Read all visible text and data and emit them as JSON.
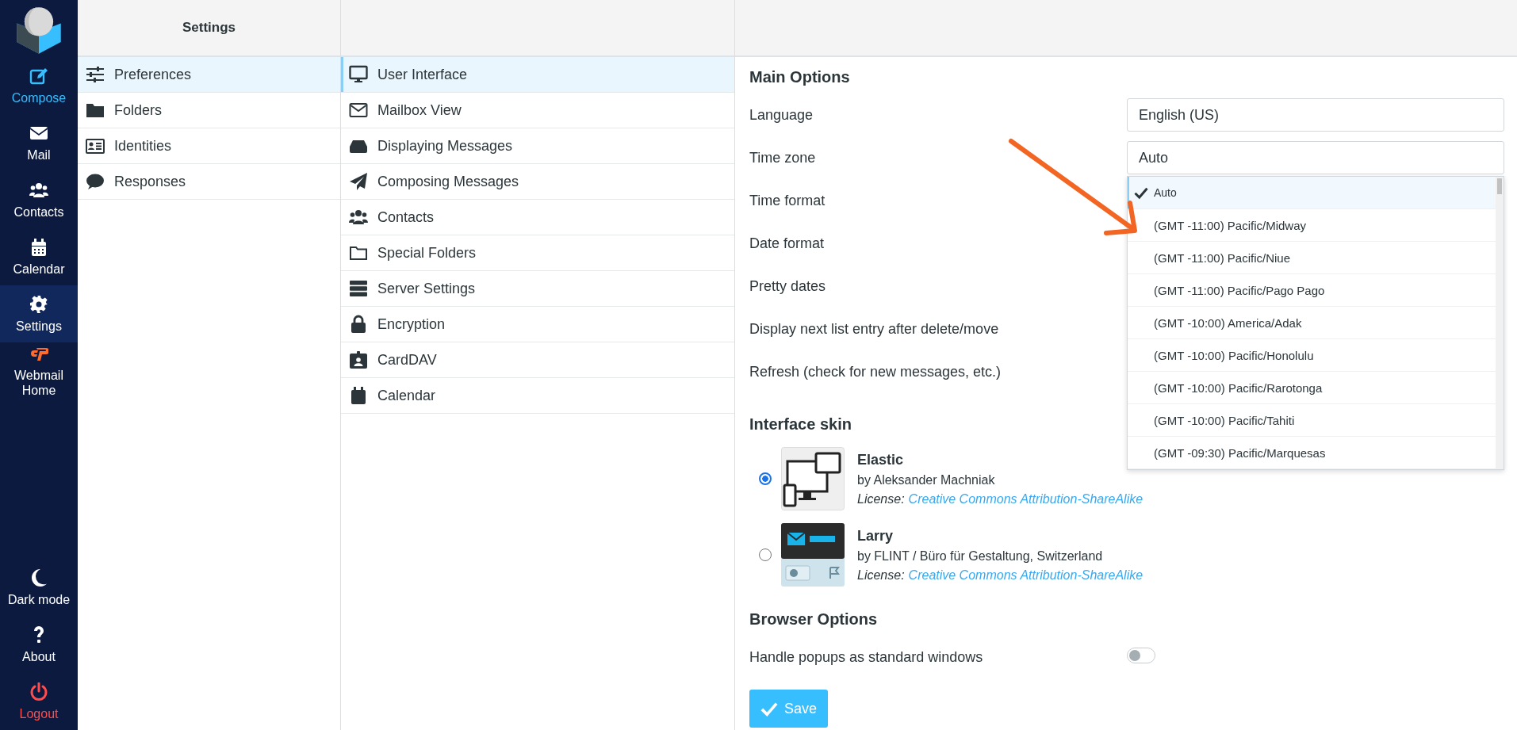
{
  "nav": {
    "items": [
      {
        "label": "Compose",
        "kind": "compose",
        "selected": false
      },
      {
        "label": "Mail",
        "kind": "mail",
        "selected": false
      },
      {
        "label": "Contacts",
        "kind": "contacts",
        "selected": false
      },
      {
        "label": "Calendar",
        "kind": "calendar",
        "selected": false
      },
      {
        "label": "Settings",
        "kind": "settings",
        "selected": true
      },
      {
        "label": "Webmail Home",
        "kind": "cpanel",
        "selected": false
      }
    ],
    "bottom_items": [
      {
        "label": "Dark mode",
        "kind": "moon",
        "selected": false
      },
      {
        "label": "About",
        "kind": "about",
        "selected": false
      },
      {
        "label": "Logout",
        "kind": "logout",
        "selected": false
      }
    ]
  },
  "settings_column": {
    "title": "Settings",
    "items": [
      {
        "label": "Preferences",
        "kind": "sliders",
        "selected": true
      },
      {
        "label": "Folders",
        "kind": "folder",
        "selected": false
      },
      {
        "label": "Identities",
        "kind": "idcard",
        "selected": false
      },
      {
        "label": "Responses",
        "kind": "comment",
        "selected": false
      }
    ]
  },
  "sections_column": {
    "items": [
      {
        "label": "User Interface",
        "kind": "monitor",
        "selected": true
      },
      {
        "label": "Mailbox View",
        "kind": "envelope",
        "selected": false
      },
      {
        "label": "Displaying Messages",
        "kind": "inbox",
        "selected": false
      },
      {
        "label": "Composing Messages",
        "kind": "plane",
        "selected": false
      },
      {
        "label": "Contacts",
        "kind": "users",
        "selected": false
      },
      {
        "label": "Special Folders",
        "kind": "folderline",
        "selected": false
      },
      {
        "label": "Server Settings",
        "kind": "server",
        "selected": false
      },
      {
        "label": "Encryption",
        "kind": "lock",
        "selected": false
      },
      {
        "label": "CardDAV",
        "kind": "badge",
        "selected": false
      },
      {
        "label": "Calendar",
        "kind": "calendar",
        "selected": false
      }
    ]
  },
  "main_options": {
    "title": "Main Options",
    "rows": [
      {
        "label": "Language",
        "value": "English (US)"
      },
      {
        "label": "Time zone",
        "value": "Auto"
      },
      {
        "label": "Time format"
      },
      {
        "label": "Date format"
      },
      {
        "label": "Pretty dates"
      },
      {
        "label": "Display next list entry after delete/move"
      },
      {
        "label": "Refresh (check for new messages, etc.)"
      }
    ]
  },
  "timezone_dropdown": {
    "options": [
      {
        "label": "Auto",
        "selected": true
      },
      {
        "label": "(GMT -11:00) Pacific/Midway",
        "selected": false
      },
      {
        "label": "(GMT -11:00) Pacific/Niue",
        "selected": false
      },
      {
        "label": "(GMT -11:00) Pacific/Pago Pago",
        "selected": false
      },
      {
        "label": "(GMT -10:00) America/Adak",
        "selected": false
      },
      {
        "label": "(GMT -10:00) Pacific/Honolulu",
        "selected": false
      },
      {
        "label": "(GMT -10:00) Pacific/Rarotonga",
        "selected": false
      },
      {
        "label": "(GMT -10:00) Pacific/Tahiti",
        "selected": false
      },
      {
        "label": "(GMT -09:30) Pacific/Marquesas",
        "selected": false
      }
    ]
  },
  "interface_skin": {
    "title": "Interface skin",
    "skins": [
      {
        "name": "Elastic",
        "kind": "elastic",
        "author": "by Aleksander Machniak",
        "license_label": "License:",
        "license_link": "Creative Commons Attribution-ShareAlike",
        "selected": true
      },
      {
        "name": "Larry",
        "kind": "larry",
        "author": "by FLINT / Büro für Gestaltung, Switzerland",
        "license_label": "License:",
        "license_link": "Creative Commons Attribution-ShareAlike",
        "selected": false
      }
    ]
  },
  "browser_options": {
    "title": "Browser Options",
    "rows": [
      {
        "label": "Handle popups as standard windows",
        "on": false
      }
    ]
  },
  "save_button": {
    "label": "Save"
  }
}
